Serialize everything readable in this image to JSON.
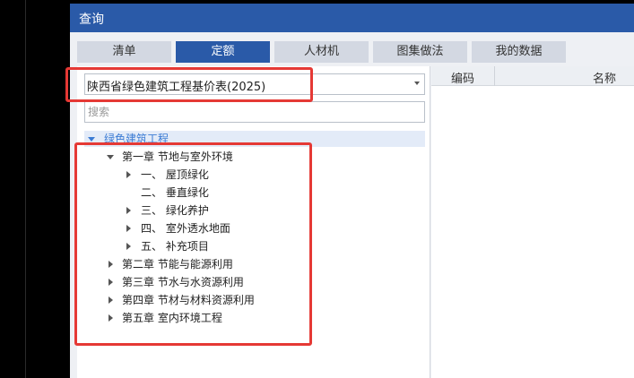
{
  "window": {
    "title": "查询"
  },
  "tabs": [
    {
      "label": "清单",
      "active": false
    },
    {
      "label": "定额",
      "active": true
    },
    {
      "label": "人材机",
      "active": false
    },
    {
      "label": "图集做法",
      "active": false
    },
    {
      "label": "我的数据",
      "active": false
    }
  ],
  "library_select": {
    "value": "陕西省绿色建筑工程基价表(2025)"
  },
  "search": {
    "placeholder": "搜索",
    "value": ""
  },
  "tree": {
    "root": "绿色建筑工程",
    "chapters": [
      {
        "label": "第一章 节地与室外环境",
        "expanded": true,
        "children": [
          {
            "label": "一、 屋顶绿化",
            "has_children": true
          },
          {
            "label": "二、 垂直绿化",
            "has_children": false
          },
          {
            "label": "三、 绿化养护",
            "has_children": true
          },
          {
            "label": "四、 室外透水地面",
            "has_children": true
          },
          {
            "label": "五、 补充项目",
            "has_children": true
          }
        ]
      },
      {
        "label": "第二章 节能与能源利用",
        "expanded": false
      },
      {
        "label": "第三章 节水与水资源利用",
        "expanded": false
      },
      {
        "label": "第四章 节材与材料资源利用",
        "expanded": false
      },
      {
        "label": "第五章 室内环境工程",
        "expanded": false
      }
    ]
  },
  "grid": {
    "columns": [
      "编码",
      "名称"
    ]
  },
  "colors": {
    "accent": "#2a5aa8",
    "highlight": "#e53935",
    "tree_root": "#3b7bd4"
  }
}
